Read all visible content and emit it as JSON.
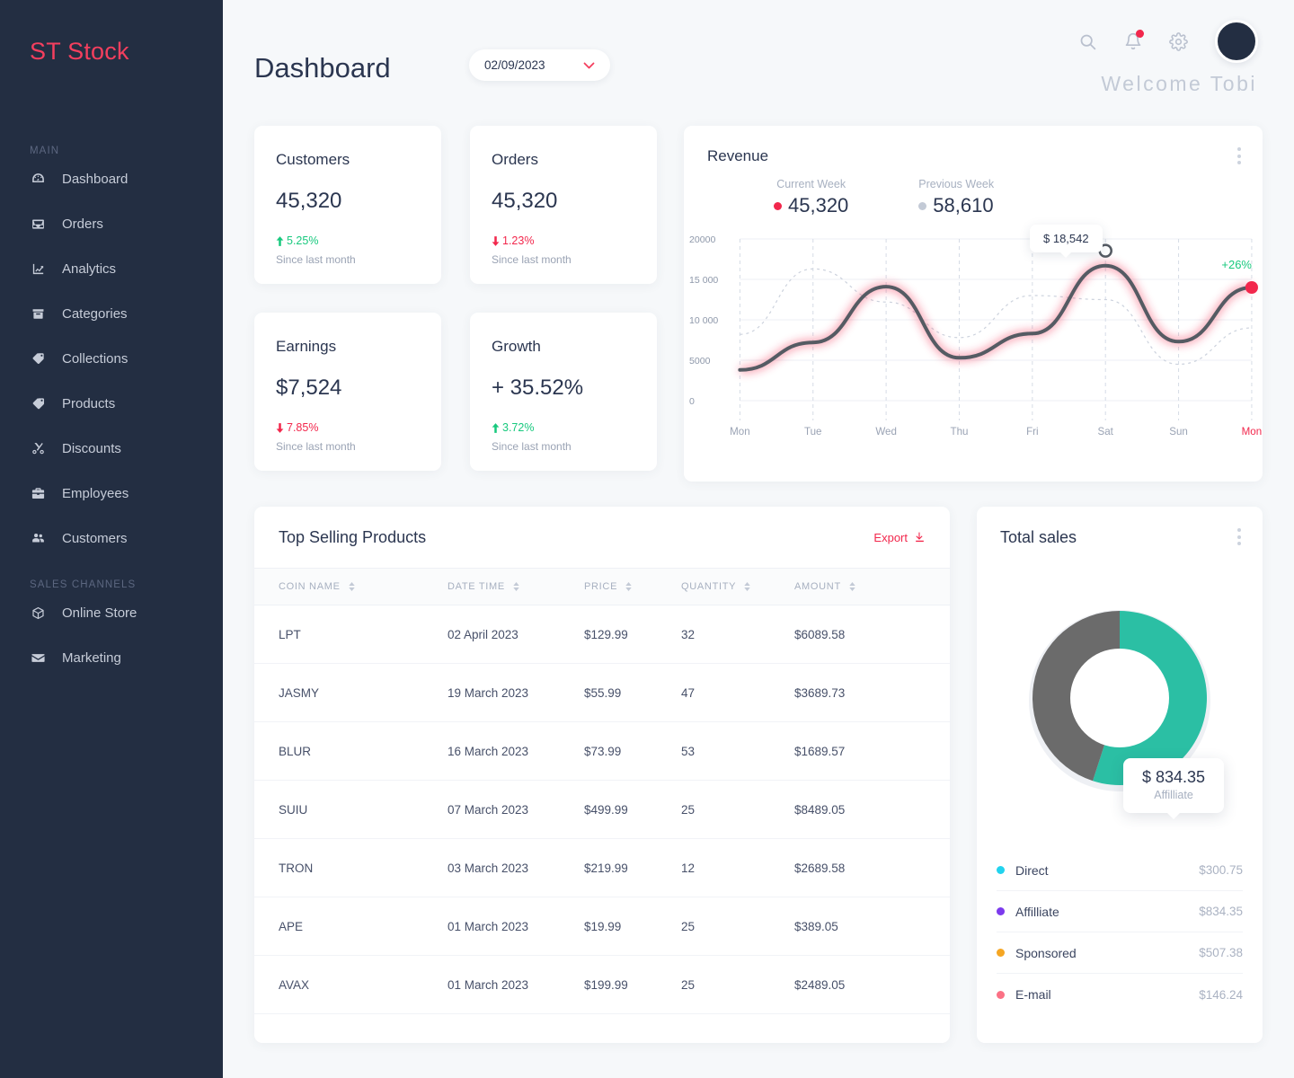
{
  "brand": "ST Stock",
  "sidebar": {
    "sections": [
      {
        "label": "MAIN",
        "items": [
          {
            "label": "Dashboard",
            "icon": "dashboard-icon"
          },
          {
            "label": "Orders",
            "icon": "inbox-icon"
          },
          {
            "label": "Analytics",
            "icon": "chart-line-icon"
          },
          {
            "label": "Categories",
            "icon": "archive-icon"
          },
          {
            "label": "Collections",
            "icon": "tags-icon"
          },
          {
            "label": "Products",
            "icon": "tag-icon"
          },
          {
            "label": "Discounts",
            "icon": "scissors-icon"
          },
          {
            "label": "Employees",
            "icon": "briefcase-icon"
          },
          {
            "label": "Customers",
            "icon": "users-icon"
          }
        ]
      },
      {
        "label": "SALES CHANNELS",
        "items": [
          {
            "label": "Online Store",
            "icon": "globe-icon"
          },
          {
            "label": "Marketing",
            "icon": "envelope-icon"
          }
        ]
      }
    ]
  },
  "header": {
    "title": "Dashboard",
    "date_value": "02/09/2023",
    "welcome": "Welcome  Tobi",
    "icons": [
      "search-icon",
      "bell-icon",
      "gear-icon",
      "avatar"
    ]
  },
  "stats": [
    {
      "title": "Customers",
      "value": "45,320",
      "delta": "5.25%",
      "dir": "up",
      "sub": "Since last month"
    },
    {
      "title": "Orders",
      "value": "45,320",
      "delta": "1.23%",
      "dir": "down",
      "sub": "Since last month"
    },
    {
      "title": "Earnings",
      "value": "$7,524",
      "delta": "7.85%",
      "dir": "down",
      "sub": "Since last month"
    },
    {
      "title": "Growth",
      "value": "+ 35.52%",
      "delta": "3.72%",
      "dir": "up",
      "sub": "Since last month"
    }
  ],
  "revenue": {
    "title": "Revenue",
    "current_label": "Current Week",
    "current_value": "45,320",
    "previous_label": "Previous Week",
    "previous_value": "58,610",
    "tooltip": "$ 18,542",
    "change": "+26%"
  },
  "chart_data": {
    "type": "line",
    "title": "Revenue",
    "xlabel": "",
    "ylabel": "",
    "categories": [
      "Mon",
      "Tue",
      "Wed",
      "Thu",
      "Fri",
      "Sat",
      "Sun",
      "Mon"
    ],
    "ytick_labels": [
      "20000",
      "15 000",
      "10 000",
      "5000",
      "0"
    ],
    "ytick_values": [
      20000,
      15000,
      10000,
      5000,
      0
    ],
    "ylim": [
      0,
      20000
    ],
    "grid": true,
    "legend_position": "top",
    "highlight_point": {
      "label": "$ 18,542",
      "value": 18542,
      "x": "Sat"
    },
    "end_point": {
      "label": "+26%",
      "value": 14000,
      "x": "Mon"
    },
    "series": [
      {
        "name": "Current Week",
        "color": "#f2274c",
        "style": "solid",
        "values": [
          3800,
          7200,
          14100,
          5300,
          8300,
          16700,
          7300,
          14000
        ]
      },
      {
        "name": "Previous Week",
        "color": "#c9cfdb",
        "style": "dotted",
        "values": [
          8200,
          16300,
          12200,
          7800,
          13000,
          12500,
          4500,
          9000
        ]
      }
    ]
  },
  "table": {
    "title": "Top Selling Products",
    "export_label": "Export",
    "columns": [
      "COIN NAME",
      "DATE TIME",
      "PRICE",
      "QUANTITY",
      "AMOUNT"
    ],
    "rows": [
      [
        "LPT",
        "02 April 2023",
        "$129.99",
        "32",
        "$6089.58"
      ],
      [
        "JASMY",
        "19 March 2023",
        "$55.99",
        "47",
        "$3689.73"
      ],
      [
        "BLUR",
        "16 March 2023",
        "$73.99",
        "53",
        "$1689.57"
      ],
      [
        "SUIU",
        "07 March 2023",
        "$499.99",
        "25",
        "$8489.05"
      ],
      [
        "TRON",
        "03 March 2023",
        "$219.99",
        "12",
        "$2689.58"
      ],
      [
        "APE",
        "01 March 2023",
        "$19.99",
        "25",
        "$389.05"
      ],
      [
        "AVAX",
        "01 March 2023",
        "$199.99",
        "25",
        "$2489.05"
      ]
    ]
  },
  "total_sales": {
    "title": "Total sales",
    "tooltip_value": "$ 834.35",
    "tooltip_label": "Affilliate",
    "donut": {
      "type": "pie",
      "segments": [
        {
          "name": "teal-segment",
          "color": "#2bbfa4",
          "percent": 55
        },
        {
          "name": "gray-segment",
          "color": "#6b6b6b",
          "percent": 45
        }
      ]
    },
    "legend": [
      {
        "name": "Direct",
        "value": "$300.75",
        "color": "#22d3ee"
      },
      {
        "name": "Affilliate",
        "value": "$834.35",
        "color": "#7c3aed"
      },
      {
        "name": "Sponsored",
        "value": "$507.38",
        "color": "#f5a623"
      },
      {
        "name": "E-mail",
        "value": "$146.24",
        "color": "#fb7185"
      }
    ]
  }
}
